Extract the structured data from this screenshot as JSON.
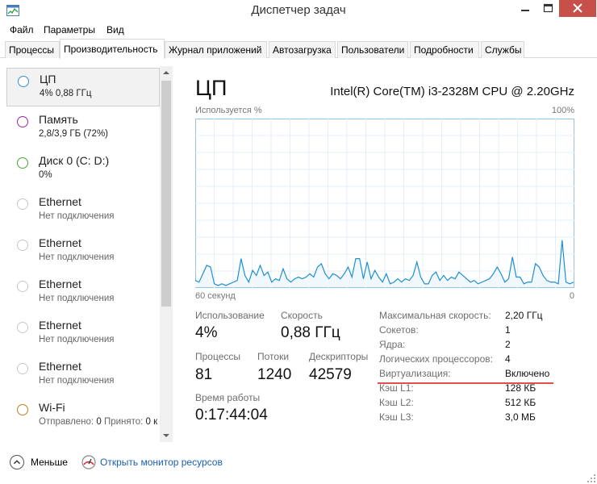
{
  "window": {
    "title": "Диспетчер задач",
    "close_color": "#c7504a"
  },
  "menu": [
    "Файл",
    "Параметры",
    "Вид"
  ],
  "tabs": [
    "Процессы",
    "Производительность",
    "Журнал приложений",
    "Автозагрузка",
    "Пользователи",
    "Подробности",
    "Службы"
  ],
  "active_tab": "Производительность",
  "sidebar": {
    "items": [
      {
        "name": "ЦП",
        "sub": "4%  0,88 ГГц",
        "color": "#3d8fd6",
        "icon": "cpu-circle-icon"
      },
      {
        "name": "Память",
        "sub": "2,8/3,9 ГБ (72%)",
        "color": "#9b2aa8",
        "icon": "memory-circle-icon"
      },
      {
        "name": "Диск 0 (C: D:)",
        "sub": "0%",
        "color": "#4aa832",
        "icon": "disk-circle-icon"
      },
      {
        "name": "Ethernet",
        "sub": "Нет подключения",
        "color": "#c8c8c8",
        "icon": "ethernet-circle-icon"
      },
      {
        "name": "Ethernet",
        "sub": "Нет подключения",
        "color": "#c8c8c8",
        "icon": "ethernet-circle-icon"
      },
      {
        "name": "Ethernet",
        "sub": "Нет подключения",
        "color": "#c8c8c8",
        "icon": "ethernet-circle-icon"
      },
      {
        "name": "Ethernet",
        "sub": "Нет подключения",
        "color": "#c8c8c8",
        "icon": "ethernet-circle-icon"
      },
      {
        "name": "Ethernet",
        "sub": "Нет подключения",
        "color": "#c8c8c8",
        "icon": "ethernet-circle-icon"
      },
      {
        "name": "Wi-Fi",
        "sub_sent_label": "Отправлено:",
        "sub_sent": "0",
        "sub_recv_label": "Принято:",
        "sub_recv": "0 к",
        "color": "#c87a2a",
        "icon": "wifi-circle-icon"
      }
    ]
  },
  "cpu": {
    "title": "ЦП",
    "model": "Intel(R) Core(TM) i3-2328M CPU @ 2.20GHz",
    "graph_label": "Используется %",
    "graph_max": "100%",
    "graph_time": "60 секунд",
    "graph_min": "0",
    "graph_color": "#1f8fd0",
    "usage_series": [
      4,
      3,
      8,
      13,
      12,
      2,
      1,
      2,
      1,
      2,
      3,
      4,
      17,
      7,
      3,
      10,
      7,
      13,
      7,
      9,
      3,
      5,
      4,
      11,
      5,
      3,
      5,
      6,
      5,
      6,
      8,
      6,
      12,
      14,
      8,
      5,
      8,
      7,
      5,
      8,
      12,
      6,
      17,
      17,
      5,
      15,
      5,
      10,
      6,
      3,
      8,
      2,
      3,
      5,
      3,
      5,
      4,
      7,
      15,
      6,
      2,
      2,
      7,
      9,
      4,
      7,
      4,
      6,
      5,
      9,
      7,
      5,
      3,
      4,
      2,
      3,
      4,
      5,
      8,
      12,
      8,
      3,
      5,
      18,
      6,
      6,
      2,
      3,
      3,
      14,
      12,
      7,
      4,
      3,
      3,
      2,
      28,
      3,
      2,
      3
    ],
    "stats": {
      "usage_label": "Использование",
      "usage": "4%",
      "speed_label": "Скорость",
      "speed": "0,88 ГГц",
      "proc_label": "Процессы",
      "proc": "81",
      "threads_label": "Потоки",
      "threads": "1240",
      "handles_label": "Дескрипторы",
      "handles": "42579",
      "uptime_label": "Время работы",
      "uptime": "0:17:44:04"
    },
    "details": [
      {
        "label": "Максимальная скорость:",
        "value": "2,20 ГГц"
      },
      {
        "label": "Сокетов:",
        "value": "1"
      },
      {
        "label": "Ядра:",
        "value": "2"
      },
      {
        "label": "Логических процессоров:",
        "value": "4"
      },
      {
        "label": "Виртуализация:",
        "value": "Включено"
      },
      {
        "label": "Кэш L1:",
        "value": "128 КБ"
      },
      {
        "label": "Кэш L2:",
        "value": "512 КБ"
      },
      {
        "label": "Кэш L3:",
        "value": "3,0 МБ"
      }
    ]
  },
  "footer": {
    "less": "Меньше",
    "monitor": "Открыть монитор ресурсов"
  }
}
